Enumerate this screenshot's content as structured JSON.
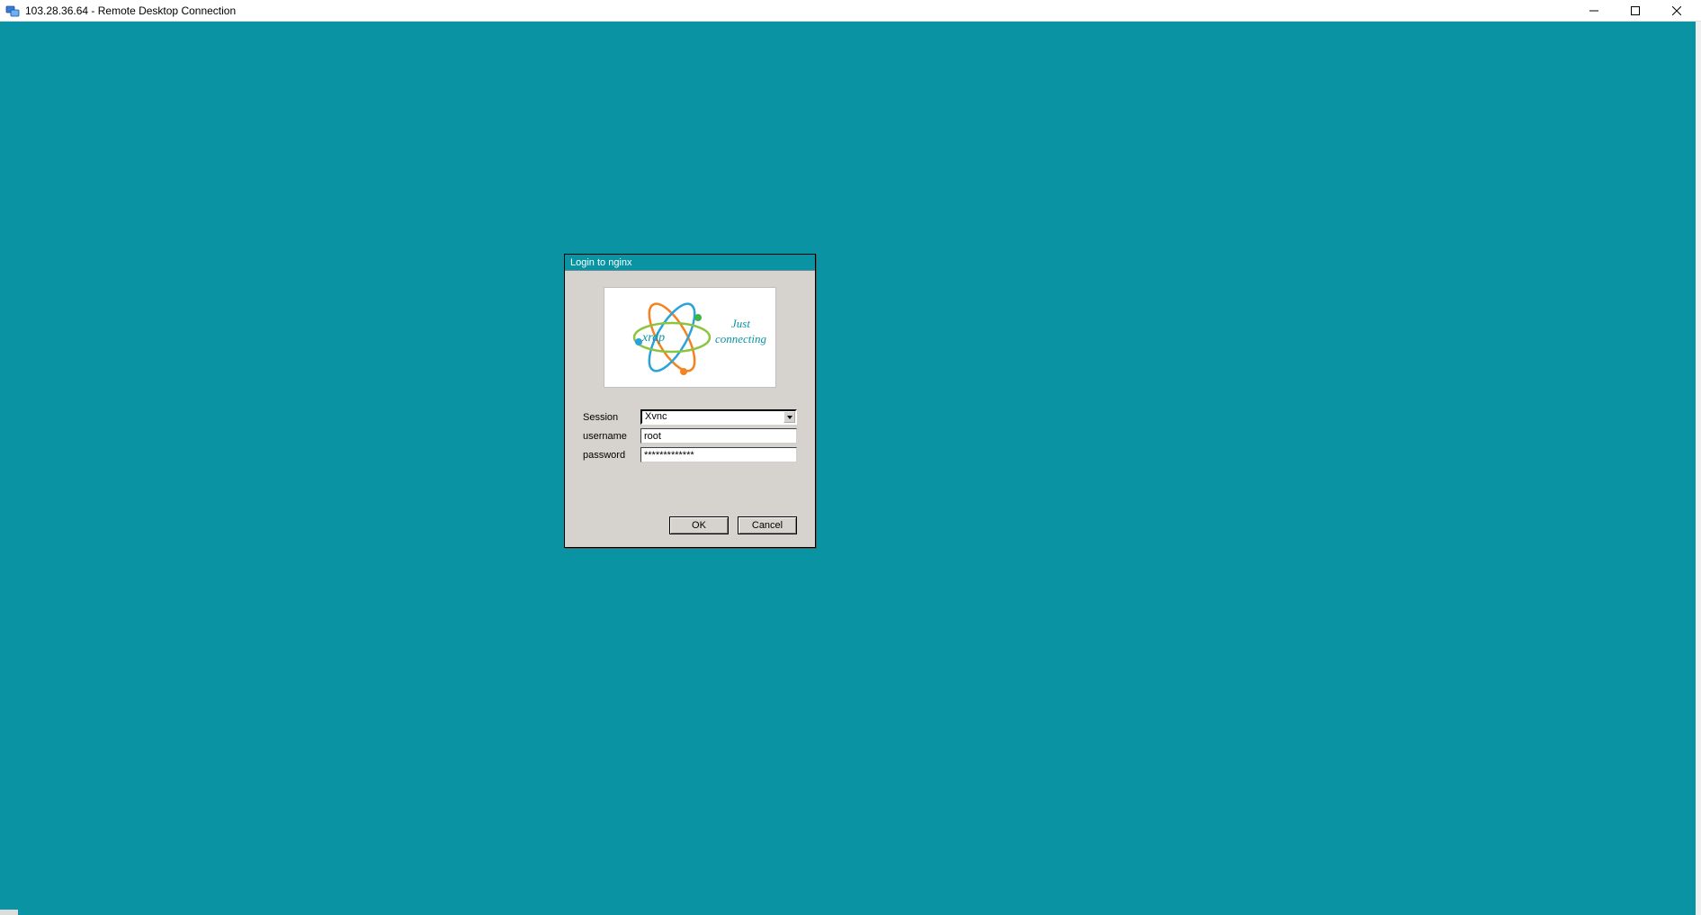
{
  "window": {
    "title": "103.28.36.64 - Remote Desktop Connection"
  },
  "dialog": {
    "title": "Login to nginx",
    "logo": {
      "name": "xrdp",
      "tagline_line1": "Just",
      "tagline_line2": "connecting"
    },
    "fields": {
      "session": {
        "label": "Session",
        "value": "Xvnc"
      },
      "username": {
        "label": "username",
        "value": "root"
      },
      "password": {
        "label": "password",
        "value": "*************"
      }
    },
    "buttons": {
      "ok": "OK",
      "cancel": "Cancel"
    }
  }
}
